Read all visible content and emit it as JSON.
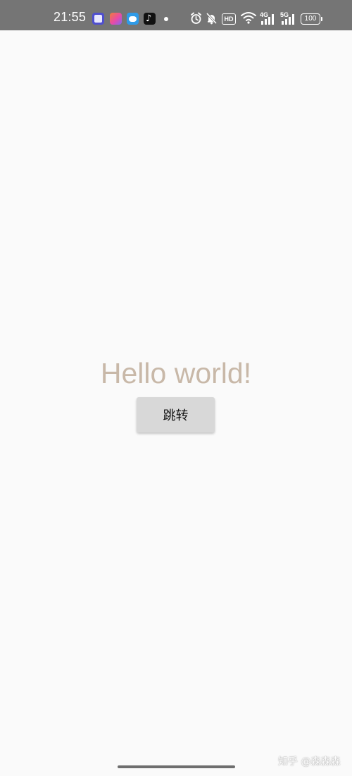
{
  "status_bar": {
    "time": "21:55",
    "app_icons": [
      "app-icon",
      "gallery-icon",
      "weather-icon",
      "tiktok-icon"
    ],
    "system_icons": [
      "alarm-icon",
      "mute-icon",
      "hd-icon",
      "wifi-icon",
      "signal-4g-icon",
      "signal-5g-icon",
      "battery-icon"
    ],
    "hd_label": "HD",
    "network_1": "4G",
    "network_2": "5G",
    "battery_level": "100",
    "background_color": "#757575"
  },
  "main": {
    "greeting": "Hello world!",
    "greeting_color": "#c8b8a8",
    "jump_button_label": "跳转",
    "button_color": "#d8d8d8"
  },
  "footer": {
    "watermark": "知乎 @森森森"
  }
}
